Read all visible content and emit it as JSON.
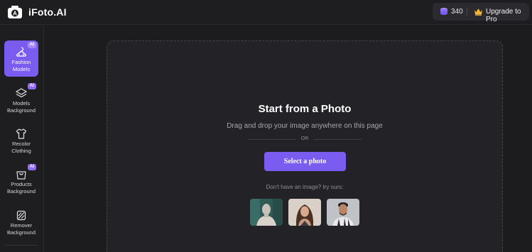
{
  "header": {
    "brand": "iFoto.AI",
    "credits": "340",
    "upgrade_label": "Upgrade to Pro",
    "logo_icon": "camera-logo-icon",
    "coin_icon": "coin-stack-icon",
    "crown_icon": "crown-icon"
  },
  "sidebar": {
    "items": [
      {
        "label": "Fashion\nModels",
        "icon": "hanger-icon",
        "badge": "AI",
        "active": true
      },
      {
        "label": "Models\nBackground",
        "icon": "layers-icon",
        "badge": "AI",
        "active": false
      },
      {
        "label": "Recolor\nClothing",
        "icon": "tshirt-icon",
        "badge": "",
        "active": false
      },
      {
        "label": "Products\nBackground",
        "icon": "shopping-bag-icon",
        "badge": "AI",
        "active": false
      },
      {
        "label": "Remover\nBackground",
        "icon": "eraser-icon",
        "badge": "",
        "active": false
      }
    ]
  },
  "main": {
    "title": "Start from a Photo",
    "subtitle": "Drag and drop your image anywhere on this page",
    "or_text": "OR",
    "select_button": "Select a photo",
    "try_text": "Don't have an image? try ours:",
    "samples": [
      "mannequin-sample",
      "woman-sample",
      "man-sample"
    ]
  },
  "colors": {
    "accent": "#7b5cf0",
    "background": "#1c1c1f",
    "panel": "#232327",
    "gold": "#f2b632"
  }
}
